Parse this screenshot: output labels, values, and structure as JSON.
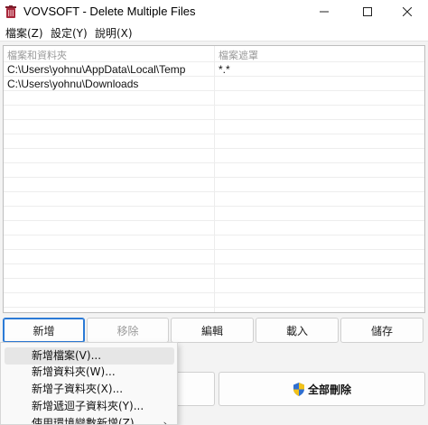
{
  "window": {
    "title": "VOVSOFT - Delete Multiple Files",
    "icons": {
      "app": "trash-icon",
      "minimize": "minimize-icon",
      "maximize": "maximize-icon",
      "close": "close-icon"
    }
  },
  "menu": {
    "items": [
      "檔案(Z)",
      "設定(Y)",
      "說明(X)"
    ]
  },
  "list": {
    "columns": [
      "檔案和資料夾",
      "檔案遮罩"
    ],
    "rows": [
      {
        "path": "C:\\Users\\yohnu\\AppData\\Local\\Temp",
        "mask": "*.*"
      },
      {
        "path": "C:\\Users\\yohnu\\Downloads",
        "mask": ""
      }
    ]
  },
  "buttons": {
    "add": "新增",
    "remove": "移除",
    "edit": "編輯",
    "load": "載入",
    "save": "儲存",
    "delete_all": "全部刪除"
  },
  "popup_menu": {
    "items": [
      "新增檔案(V)...",
      "新增資料夾(W)...",
      "新增子資料夾(X)...",
      "新增遞迴子資料夾(Y)...",
      "使用環境變數新增(Z)"
    ],
    "submenu_icon": "chevron-right-icon",
    "shield_icon": "uac-shield-icon"
  }
}
